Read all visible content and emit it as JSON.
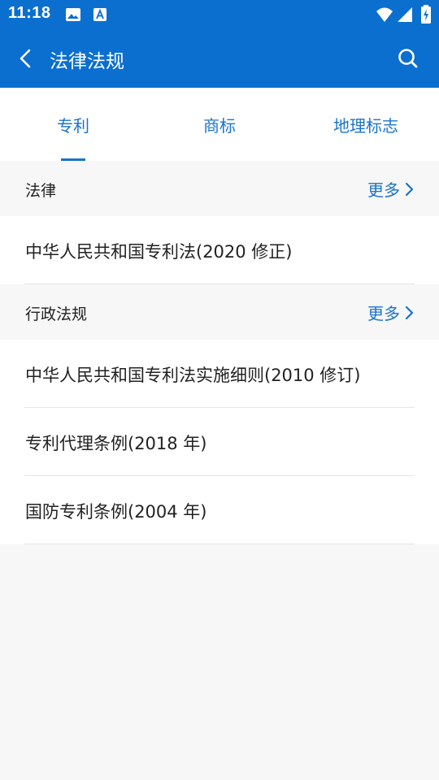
{
  "status_bar": {
    "time": "11:18",
    "icons": [
      "image-icon",
      "a-font-icon",
      "wifi-icon",
      "signal-icon",
      "battery-icon"
    ]
  },
  "app_bar": {
    "title": "法律法规",
    "back_icon": "chevron-left-icon",
    "search_icon": "search-icon"
  },
  "tabs": [
    {
      "label": "专利",
      "selected": true
    },
    {
      "label": "商标",
      "selected": false
    },
    {
      "label": "地理标志",
      "selected": false
    }
  ],
  "sections": [
    {
      "title": "法律",
      "more_label": "更多",
      "items": [
        "中华人民共和国专利法(2020 修正)"
      ]
    },
    {
      "title": "行政法规",
      "more_label": "更多",
      "items": [
        "中华人民共和国专利法实施细则(2010 修订)",
        "专利代理条例(2018 年)",
        "国防专利条例(2004 年)"
      ]
    }
  ],
  "colors": {
    "primary": "#0b6fd0",
    "accent": "#1a73c9",
    "background": "#f7f7f7"
  }
}
